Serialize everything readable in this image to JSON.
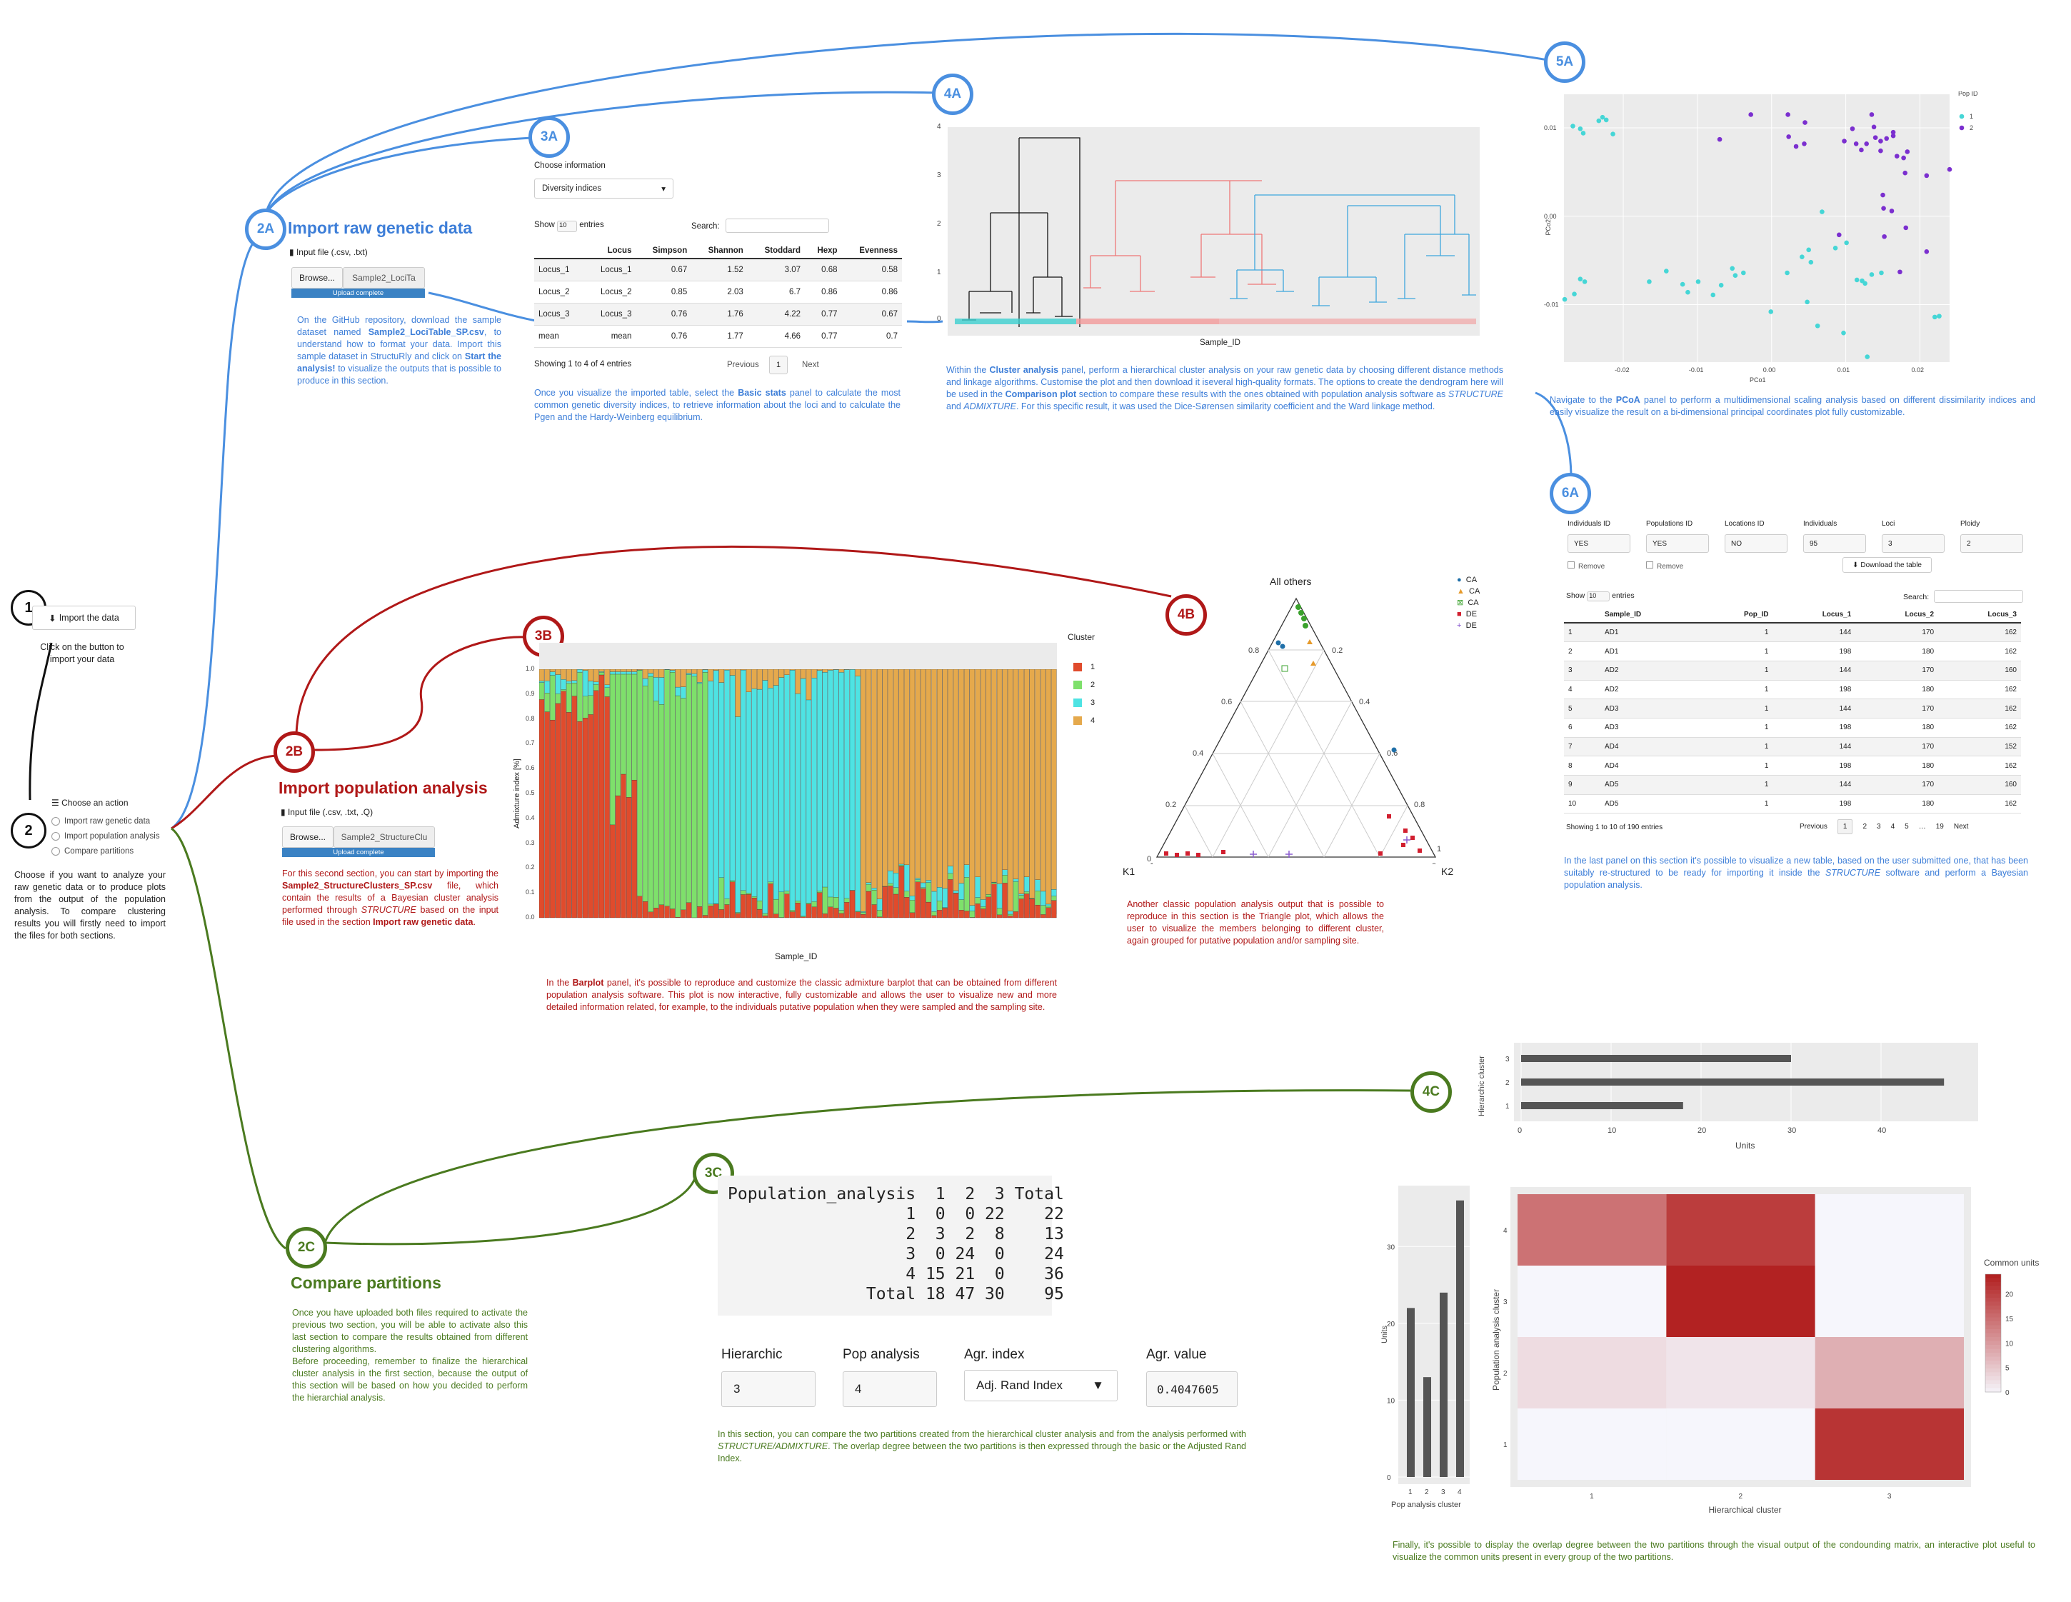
{
  "step1": {
    "num": "1",
    "button": "Import the data",
    "caption": "Click on the button to import your data"
  },
  "step2": {
    "num": "2",
    "title": "Choose an action",
    "options": [
      "Import raw genetic data",
      "Import population analysis",
      "Compare partitions"
    ],
    "caption": "Choose if you want to analyze your raw genetic data or to produce plots from the output of the population analysis. To compare clustering results you will firstly need to import the files for both sections."
  },
  "s2A": {
    "num": "2A",
    "title": "Import raw genetic data",
    "input_label": "Input file (.csv, .txt)",
    "browse": "Browse...",
    "file": "Sample2_LociTa",
    "progress": "Upload complete",
    "desc_1": "On the GitHub repository, download the sample dataset named ",
    "desc_file": "Sample2_LociTable_SP.csv",
    "desc_2": ", to understand how to format your data. Import this sample dataset in StructuRly and click on ",
    "desc_bold": "Start the analysis!",
    "desc_3": " to visualize the outputs that is possible to produce in this section."
  },
  "s3A": {
    "num": "3A",
    "choose": "Choose information",
    "select": "Diversity indices",
    "show": "Show",
    "entries_n": "10",
    "entries": "entries",
    "search": "Search:",
    "headers": [
      "",
      "Locus",
      "Simpson",
      "Shannon",
      "Stoddard",
      "Hexp",
      "Evenness"
    ],
    "rows": [
      [
        "Locus_1",
        "Locus_1",
        "0.67",
        "1.52",
        "3.07",
        "0.68",
        "0.58"
      ],
      [
        "Locus_2",
        "Locus_2",
        "0.85",
        "2.03",
        "6.7",
        "0.86",
        "0.86"
      ],
      [
        "Locus_3",
        "Locus_3",
        "0.76",
        "1.76",
        "4.22",
        "0.77",
        "0.67"
      ],
      [
        "mean",
        "mean",
        "0.76",
        "1.77",
        "4.66",
        "0.77",
        "0.7"
      ]
    ],
    "info": "Showing 1 to 4 of 4 entries",
    "prev": "Previous",
    "page": "1",
    "next": "Next",
    "desc_1": "Once you visualize the imported table, select the ",
    "desc_bold": "Basic stats",
    "desc_2": " panel to calculate the most common genetic diversity indices, to retrieve information about the loci and to calculate the Pgen and the Hardy-Weinberg equilibrium."
  },
  "s4A": {
    "num": "4A",
    "xlabel": "Sample_ID",
    "yticks": [
      "0",
      "1",
      "2",
      "3",
      "4"
    ],
    "desc_1": "Within the ",
    "desc_b1": "Cluster analysis",
    "desc_2": " panel, perform a hierarchical cluster analysis on your raw genetic data by choosing different distance methods and linkage algorithms. Customise the plot and then download it iseveral high-quality formats. The options to create the dendrogram here will be used in the ",
    "desc_b2": "Comparison plot",
    "desc_3": " section to compare these results with the ones obtained with population analysis software as ",
    "desc_i1": "STRUCTURE",
    "desc_4": " and ",
    "desc_i2": "ADMIXTURE",
    "desc_5": ". For this specific result, it was used the Dice-Sørensen similarity coefficient and the Ward linkage method."
  },
  "s5A": {
    "num": "5A",
    "xlabel": "PCo1",
    "ylabel": "PCo2",
    "legend_title": "Pop ID",
    "legend": [
      "1",
      "2"
    ],
    "xticks": [
      "-0.02",
      "-0.01",
      "0.00",
      "0.01",
      "0.02"
    ],
    "yticks": [
      "0.01",
      "0.00",
      "-0.01"
    ],
    "desc_1": "Navigate to the ",
    "desc_bold": "PCoA",
    "desc_2": " panel to perform a multidimensional scaling analysis based on different dissimilarity indices and easily visualize the result on a bi-dimensional principal coordinates plot fully customizable."
  },
  "s6A": {
    "num": "6A",
    "fields": [
      {
        "label": "Individuals ID",
        "value": "YES"
      },
      {
        "label": "Populations ID",
        "value": "YES"
      },
      {
        "label": "Locations ID",
        "value": "NO"
      },
      {
        "label": "Individuals",
        "value": "95"
      },
      {
        "label": "Loci",
        "value": "3"
      },
      {
        "label": "Ploidy",
        "value": "2"
      }
    ],
    "remove": "Remove",
    "download": "Download the table",
    "show": "Show",
    "entries_n": "10",
    "entries": "entries",
    "search": "Search:",
    "headers": [
      "",
      "Sample_ID",
      "Pop_ID",
      "Locus_1",
      "Locus_2",
      "Locus_3"
    ],
    "rows": [
      [
        "1",
        "AD1",
        "1",
        "144",
        "170",
        "162"
      ],
      [
        "2",
        "AD1",
        "1",
        "198",
        "180",
        "162"
      ],
      [
        "3",
        "AD2",
        "1",
        "144",
        "170",
        "160"
      ],
      [
        "4",
        "AD2",
        "1",
        "198",
        "180",
        "162"
      ],
      [
        "5",
        "AD3",
        "1",
        "144",
        "170",
        "162"
      ],
      [
        "6",
        "AD3",
        "1",
        "198",
        "180",
        "162"
      ],
      [
        "7",
        "AD4",
        "1",
        "144",
        "170",
        "152"
      ],
      [
        "8",
        "AD4",
        "1",
        "198",
        "180",
        "162"
      ],
      [
        "9",
        "AD5",
        "1",
        "144",
        "170",
        "160"
      ],
      [
        "10",
        "AD5",
        "1",
        "198",
        "180",
        "162"
      ]
    ],
    "info": "Showing 1 to 10 of 190 entries",
    "prev": "Previous",
    "pages": [
      "1",
      "2",
      "3",
      "4",
      "5",
      "…",
      "19"
    ],
    "next": "Next",
    "desc_1": "In the last panel on this section it's possible to visualize a new table, based on the user submitted one, that has been suitably re-structured to be ready for importing it inside the ",
    "desc_i": "STRUCTURE",
    "desc_2": " software and perform a Bayesian population analysis."
  },
  "s2B": {
    "num": "2B",
    "title": "Import population analysis",
    "input_label": "Input file (.csv, .txt, .Q)",
    "browse": "Browse...",
    "file": "Sample2_StructureClu",
    "progress": "Upload complete",
    "desc_1": "For this second section, you can start by importing the ",
    "desc_b1": "Sample2_StructureClusters_SP.csv",
    "desc_2": " file, which contain the results of a Bayesian cluster analysis performed through ",
    "desc_i": "STRUCTURE",
    "desc_3": " based on the input file used in the section ",
    "desc_b2": "Import raw genetic data",
    "desc_4": "."
  },
  "s3B": {
    "num": "3B",
    "ylabel": "Admixture index [%]",
    "xlabel": "Sample_ID",
    "legend_title": "Cluster",
    "legend": [
      "1",
      "2",
      "3",
      "4"
    ],
    "yticks": [
      "0.0",
      "0.1",
      "0.2",
      "0.3",
      "0.4",
      "0.5",
      "0.6",
      "0.7",
      "0.8",
      "0.9",
      "1.0"
    ],
    "desc_1": "In the ",
    "desc_bold": "Barplot",
    "desc_2": " panel, it's possible to reproduce and customize the classic admixture barplot that can be obtained from different population analysis software. This plot is now interactive, fully customizable and allows the user to visualize new and more detailed information related, for example, to the individuals putative population when they were sampled and the sampling site."
  },
  "s4B": {
    "num": "4B",
    "top": "All others",
    "k1": "K1",
    "k2": "K2",
    "legend": [
      "CA",
      "CA",
      "CA",
      "DE",
      "DE"
    ],
    "desc": "Another classic population analysis output that is possible to reproduce in this section is the Triangle plot, which allows the user to visualize the members belonging to different cluster, again grouped for putative population and/or sampling site."
  },
  "s2C": {
    "num": "2C",
    "title": "Compare partitions",
    "desc": "Once you have uploaded both files required to activate the previous two section, you will be able to activate also this last section to compare the results obtained from different clustering algorithms.\nBefore proceeding, remember to finalize the hierarchical cluster analysis in the first section, because the output of this section will be based on how you decided to perform the hierarchial analysis."
  },
  "s3C": {
    "num": "3C",
    "matrix": [
      "Population_analysis  1  2  3 Total",
      "                  1  0  0 22    22",
      "                  2  3  2  8    13",
      "                  3  0 24  0    24",
      "                  4 15 21  0    36",
      "              Total 18 47 30    95"
    ],
    "labels": [
      "Hierarchic",
      "Pop analysis",
      "Agr. index",
      "Agr. value"
    ],
    "values": [
      "3",
      "4",
      "Adj. Rand Index",
      "0.4047605"
    ],
    "desc_1": "In this section, you can compare the two partitions created from the hierarchical cluster analysis and from the analysis performed with ",
    "desc_i": "STRUCTURE/ADMIXTURE",
    "desc_2": ". The overlap degree between the two partitions is then expressed through the basic or the Adjusted Rand Index."
  },
  "s4C": {
    "num": "4C",
    "xlabel": "Units",
    "ylabel": "Hierarchic cluster",
    "bar_ylabel": "Units",
    "bar_xlabel": "Pop analysis cluster",
    "heat_xlabel": "Hierarchical cluster",
    "heat_ylabel": "Population analysis cluster",
    "legend_title": "Common units",
    "desc": "Finally, it's possible to display the overlap degree between the two partitions through the visual output of the condounding matrix, an interactive plot useful to visualize the common units present in every group of the two partitions."
  },
  "chart_data": [
    {
      "type": "bar",
      "id": "hierarchic-units",
      "orientation": "horizontal",
      "categories": [
        "1",
        "2",
        "3"
      ],
      "values": [
        18,
        47,
        30
      ],
      "xlabel": "Units",
      "ylabel": "Hierarchic cluster",
      "xticks": [
        0,
        10,
        20,
        30,
        40
      ],
      "xlim": [
        0,
        50
      ]
    },
    {
      "type": "bar",
      "id": "pop-units",
      "categories": [
        "1",
        "2",
        "3",
        "4"
      ],
      "values": [
        22,
        13,
        24,
        36
      ],
      "xlabel": "Pop analysis cluster",
      "ylabel": "Units",
      "yticks": [
        0,
        10,
        20,
        30
      ],
      "ylim": [
        0,
        37
      ]
    },
    {
      "type": "heatmap",
      "id": "confusion",
      "x": [
        "1",
        "2",
        "3"
      ],
      "y": [
        "1",
        "2",
        "3",
        "4"
      ],
      "values": [
        [
          0,
          0,
          22
        ],
        [
          3,
          2,
          8
        ],
        [
          0,
          24,
          0
        ],
        [
          15,
          21,
          0
        ]
      ],
      "xlabel": "Hierarchical cluster",
      "ylabel": "Population analysis cluster",
      "legend_title": "Common units",
      "legend_ticks": [
        0,
        5,
        10,
        15,
        20
      ],
      "range": [
        0,
        24
      ]
    },
    {
      "type": "scatter",
      "id": "pcoa",
      "xlabel": "PCo1",
      "ylabel": "PCo2",
      "legend_title": "Pop ID",
      "xlim": [
        -0.028,
        0.024
      ],
      "ylim": [
        -0.0165,
        0.0138
      ],
      "series": [
        {
          "name": "1",
          "color": "#45d6d6",
          "points": [
            [
              -0.0254,
              0.0094
            ],
            [
              -0.0258,
              0.0099
            ],
            [
              -0.0233,
              0.0108
            ],
            [
              -0.0228,
              0.0112
            ],
            [
              -0.0223,
              0.0109
            ],
            [
              -0.0268,
              0.0102
            ],
            [
              -0.0214,
              0.0093
            ],
            [
              -0.0258,
              -0.0071
            ],
            [
              -0.0279,
              -0.0094
            ],
            [
              -0.0266,
              -0.0088
            ],
            [
              -0.0252,
              -0.0074
            ],
            [
              -0.0165,
              -0.0074
            ],
            [
              -0.0142,
              -0.0062
            ],
            [
              -0.012,
              -0.0077
            ],
            [
              -0.0113,
              -0.0086
            ],
            [
              -0.0099,
              -0.0074
            ],
            [
              -0.0079,
              -0.0089
            ],
            [
              -0.0068,
              -0.0078
            ],
            [
              -0.0049,
              -0.0067
            ],
            [
              -0.0053,
              -0.0059
            ],
            [
              -0.0038,
              -0.0064
            ],
            [
              0.0021,
              -0.0064
            ],
            [
              0.0041,
              -0.0046
            ],
            [
              0.005,
              -0.0038
            ],
            [
              0.0053,
              -0.0052
            ],
            [
              0.0068,
              0.0005
            ],
            [
              0.0086,
              -0.0036
            ],
            [
              0.0101,
              -0.003
            ],
            [
              0.0048,
              -0.0097
            ],
            [
              0.0062,
              -0.0124
            ],
            [
              0.0115,
              -0.0072
            ],
            [
              0.0122,
              -0.0073
            ],
            [
              0.0126,
              -0.0076
            ],
            [
              0.0135,
              -0.0066
            ],
            [
              0.0148,
              -0.0064
            ],
            [
              0.0097,
              -0.0132
            ],
            [
              0.0129,
              -0.0159
            ],
            [
              0.022,
              -0.0114
            ],
            [
              0.0226,
              -0.0113
            ],
            [
              -0.0001,
              -0.0108
            ]
          ]
        },
        {
          "name": "2",
          "color": "#7b2fcf",
          "points": [
            [
              0.0023,
              0.009
            ],
            [
              0.0033,
              0.0079
            ],
            [
              0.0045,
              0.0106
            ],
            [
              0.0022,
              0.0115
            ],
            [
              0.0044,
              0.0082
            ],
            [
              -0.007,
              0.0087
            ],
            [
              -0.0028,
              0.0115
            ],
            [
              0.0098,
              0.0085
            ],
            [
              0.0121,
              0.0075
            ],
            [
              0.0138,
              0.0101
            ],
            [
              0.0135,
              0.0115
            ],
            [
              0.0147,
              0.0085
            ],
            [
              0.0128,
              0.0082
            ],
            [
              0.0114,
              0.0082
            ],
            [
              0.0109,
              0.0099
            ],
            [
              0.014,
              0.0089
            ],
            [
              0.0155,
              0.0088
            ],
            [
              0.0164,
              0.0095
            ],
            [
              0.0178,
              0.0066
            ],
            [
              0.0147,
              0.0074
            ],
            [
              0.0164,
              0.0091
            ],
            [
              0.0183,
              0.0073
            ],
            [
              0.0169,
              0.0068
            ],
            [
              0.0209,
              0.0046
            ],
            [
              0.018,
              0.0049
            ],
            [
              0.024,
              0.0053
            ],
            [
              0.015,
              0.0024
            ],
            [
              0.0162,
              0.0006
            ],
            [
              0.0181,
              -0.0013
            ],
            [
              0.0209,
              -0.004
            ],
            [
              0.0152,
              -0.0023
            ],
            [
              0.0091,
              -0.0021
            ],
            [
              0.0173,
              -0.0063
            ],
            [
              0.0151,
              0.0009
            ]
          ]
        }
      ]
    },
    {
      "type": "bar",
      "id": "admixture",
      "stacked": true,
      "ylabel": "Admixture index [%]",
      "xlabel": "Sample_ID",
      "legend_title": "Cluster",
      "ylim": [
        0,
        1
      ],
      "series_names": [
        "1",
        "2",
        "3",
        "4"
      ],
      "colors": [
        "#e04b2c",
        "#7ee06b",
        "#4ee3e3",
        "#e5a94c"
      ],
      "group_sizes": {
        "1": 13,
        "2": 18,
        "3": 28,
        "4": 36
      }
    },
    {
      "type": "scatter",
      "id": "triangle",
      "xlabel": "K1",
      "ylabel": "K2",
      "title": "All others",
      "legend": [
        "CA",
        "CA",
        "CA",
        "DE",
        "DE"
      ]
    }
  ],
  "colors": {
    "blue": "#3d7ed8",
    "red": "#b01818",
    "green": "#4a7a1f",
    "black": "#111111"
  }
}
